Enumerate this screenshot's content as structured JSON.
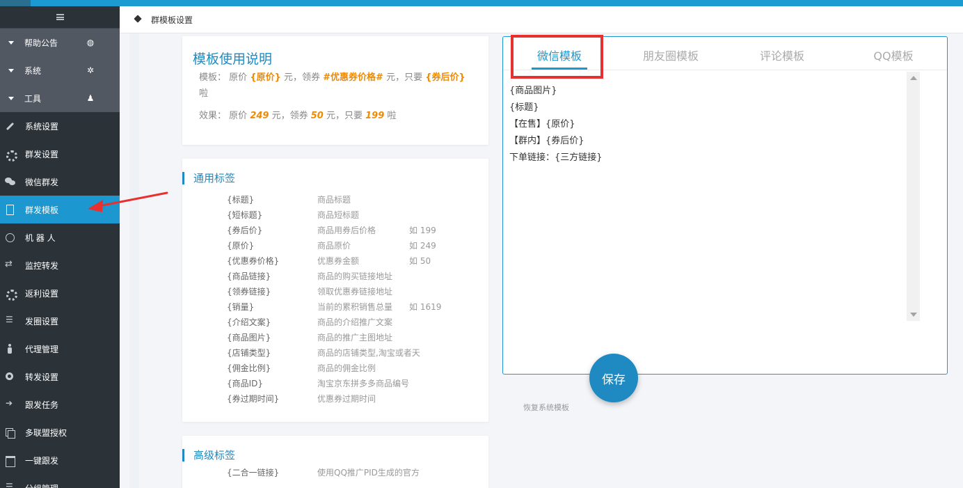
{
  "header": {
    "breadcrumb": "群模板设置"
  },
  "sidebar": {
    "groups": [
      {
        "label": "帮助公告",
        "icon": "dashboard-icon"
      },
      {
        "label": "系统",
        "icon": "gear-icon"
      },
      {
        "label": "工具",
        "icon": "android-icon"
      }
    ],
    "items": [
      {
        "label": "系统设置",
        "icon": "wrench-icon"
      },
      {
        "label": "群发设置",
        "icon": "gears-icon"
      },
      {
        "label": "微信群发",
        "icon": "wechat-icon"
      },
      {
        "label": "群发模板",
        "icon": "document-icon",
        "active": true
      },
      {
        "label": "机 器 人",
        "icon": "smile-icon"
      },
      {
        "label": "监控转发",
        "icon": "retweet-icon"
      },
      {
        "label": "返利设置",
        "icon": "gear-icon"
      },
      {
        "label": "发圈设置",
        "icon": "sliders-icon"
      },
      {
        "label": "代理管理",
        "icon": "person-icon"
      },
      {
        "label": "转发设置",
        "icon": "eye-icon"
      },
      {
        "label": "跟发任务",
        "icon": "arrow-right-icon"
      },
      {
        "label": "多联盟授权",
        "icon": "copy-icon"
      },
      {
        "label": "一键跟发",
        "icon": "calendar-icon"
      },
      {
        "label": "分组管理",
        "icon": "list-icon"
      }
    ]
  },
  "usage": {
    "title": "模板使用说明",
    "template_label": "模板：",
    "template_p1": "原价",
    "template_t1": "{原价}",
    "template_p2": "元，领券",
    "template_t2": "#优惠券价格#",
    "template_p3": "元，只要",
    "template_t3": "{券后价}",
    "template_p4": "啦",
    "effect_label": "效果：",
    "effect_p1": "原价",
    "effect_v1": "249",
    "effect_p2": "元，领券",
    "effect_v2": "50",
    "effect_p3": "元，只要",
    "effect_v3": "199",
    "effect_p4": "啦"
  },
  "common_tags": {
    "title": "通用标签",
    "rows": [
      {
        "tag": "{标题}",
        "desc": "商品标题",
        "example": ""
      },
      {
        "tag": "{短标题}",
        "desc": "商品短标题",
        "example": ""
      },
      {
        "tag": "{券后价}",
        "desc": "商品用券后价格",
        "example": "如 199"
      },
      {
        "tag": "{原价}",
        "desc": "商品原价",
        "example": "如 249"
      },
      {
        "tag": "{优惠券价格}",
        "desc": "优惠券金额",
        "example": "如 50"
      },
      {
        "tag": "{商品链接}",
        "desc": "商品的购买链接地址",
        "example": ""
      },
      {
        "tag": "{领券链接}",
        "desc": "领取优惠券链接地址",
        "example": ""
      },
      {
        "tag": "{销量}",
        "desc": "当前的累积销售总量",
        "example": "如 1619"
      },
      {
        "tag": "{介绍文案}",
        "desc": "商品的介绍推广文案",
        "example": ""
      },
      {
        "tag": "{商品图片}",
        "desc": "商品的推广主图地址",
        "example": ""
      },
      {
        "tag": "{店铺类型}",
        "desc": "商品的店铺类型,淘宝或者天",
        "example": ""
      },
      {
        "tag": "{佣金比例}",
        "desc": "商品的佣金比例",
        "example": ""
      },
      {
        "tag": "{商品ID}",
        "desc": "淘宝京东拼多多商品编号",
        "example": ""
      },
      {
        "tag": "{券过期时间}",
        "desc": "优惠券过期时间",
        "example": ""
      }
    ]
  },
  "advanced_tags": {
    "title": "高级标签",
    "rows": [
      {
        "tag": "{二合一链接}",
        "desc": "使用QQ推广PID生成的官方"
      }
    ]
  },
  "editor": {
    "tabs": [
      "微信模板",
      "朋友圈模板",
      "评论模板",
      "QQ模板"
    ],
    "active_tab": 0,
    "lines": [
      "{商品图片}",
      "{标题}",
      "【在售】{原价}",
      "【群内】{券后价}",
      "下单链接：{三方链接}"
    ]
  },
  "actions": {
    "save": "保存",
    "restore": "恢复系统模板"
  },
  "colors": {
    "accent": "#1c97cf",
    "highlight": "#f08a00",
    "annotation": "#e73131",
    "sidebar": "#2b3339"
  }
}
